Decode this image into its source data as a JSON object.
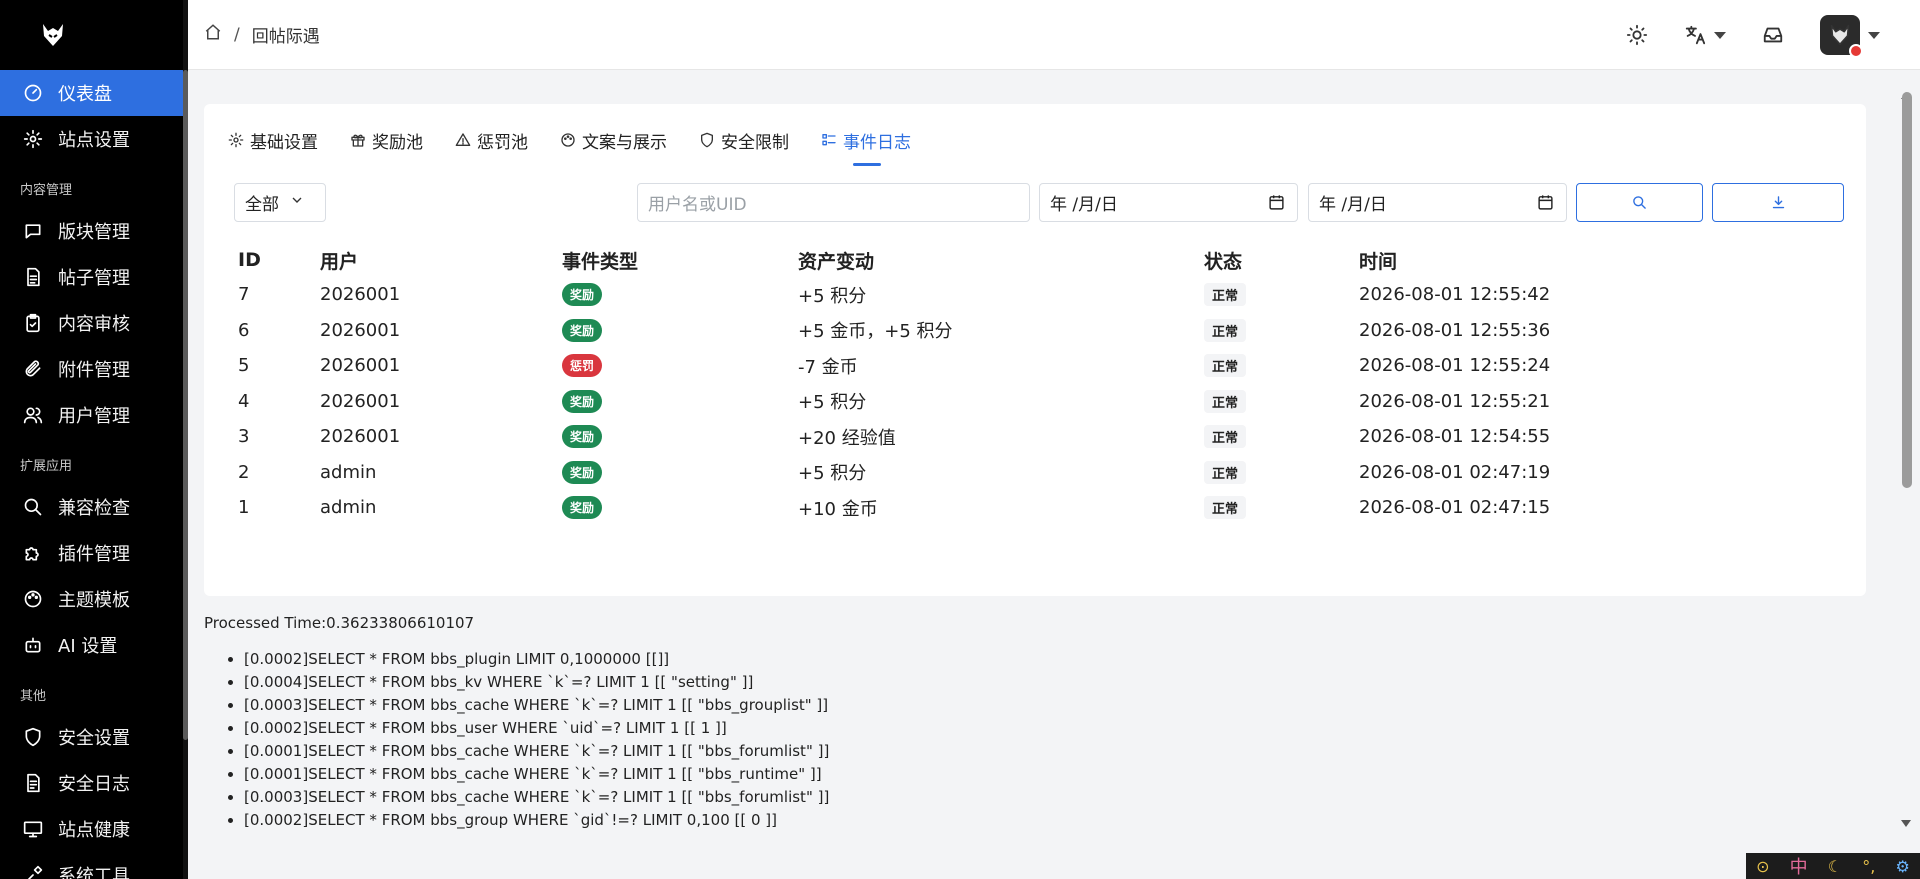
{
  "header": {
    "breadcrumb": "回帖际遇"
  },
  "sidebar": {
    "items": [
      {
        "label": "仪表盘",
        "icon": "dashboard-icon",
        "active": true
      },
      {
        "label": "站点设置",
        "icon": "gear-icon"
      }
    ],
    "sections": [
      {
        "title": "内容管理",
        "items": [
          {
            "label": "版块管理",
            "icon": "chat-icon"
          },
          {
            "label": "帖子管理",
            "icon": "document-icon"
          },
          {
            "label": "内容审核",
            "icon": "clipboard-check-icon"
          },
          {
            "label": "附件管理",
            "icon": "paperclip-icon"
          },
          {
            "label": "用户管理",
            "icon": "users-icon"
          }
        ]
      },
      {
        "title": "扩展应用",
        "items": [
          {
            "label": "兼容检查",
            "icon": "search-icon"
          },
          {
            "label": "插件管理",
            "icon": "puzzle-icon"
          },
          {
            "label": "主题模板",
            "icon": "palette-icon"
          },
          {
            "label": "AI 设置",
            "icon": "robot-icon"
          }
        ]
      },
      {
        "title": "其他",
        "items": [
          {
            "label": "安全设置",
            "icon": "shield-icon"
          },
          {
            "label": "安全日志",
            "icon": "log-icon"
          },
          {
            "label": "站点健康",
            "icon": "monitor-icon"
          },
          {
            "label": "系统工具",
            "icon": "tools-icon"
          }
        ]
      }
    ]
  },
  "tabs": [
    {
      "label": "基础设置",
      "icon": "gear-icon"
    },
    {
      "label": "奖励池",
      "icon": "gift-icon"
    },
    {
      "label": "惩罚池",
      "icon": "warning-icon"
    },
    {
      "label": "文案与展示",
      "icon": "palette-icon"
    },
    {
      "label": "安全限制",
      "icon": "shield-icon"
    },
    {
      "label": "事件日志",
      "icon": "list-icon",
      "active": true
    }
  ],
  "filters": {
    "type_select": "全部",
    "uid_placeholder": "用户名或UID",
    "date_from": "年 /月/日",
    "date_to": "年 /月/日"
  },
  "table": {
    "columns": [
      "ID",
      "用户",
      "事件类型",
      "资产变动",
      "状态",
      "时间"
    ],
    "rows": [
      {
        "id": "7",
        "user": "2026001",
        "type": "奖励",
        "kind": "reward",
        "asset": "+5 积分",
        "status": "正常",
        "time": "2026-08-01 12:55:42"
      },
      {
        "id": "6",
        "user": "2026001",
        "type": "奖励",
        "kind": "reward",
        "asset": "+5 金币，+5 积分",
        "status": "正常",
        "time": "2026-08-01 12:55:36"
      },
      {
        "id": "5",
        "user": "2026001",
        "type": "惩罚",
        "kind": "penalty",
        "asset": "-7 金币",
        "status": "正常",
        "time": "2026-08-01 12:55:24"
      },
      {
        "id": "4",
        "user": "2026001",
        "type": "奖励",
        "kind": "reward",
        "asset": "+5 积分",
        "status": "正常",
        "time": "2026-08-01 12:55:21"
      },
      {
        "id": "3",
        "user": "2026001",
        "type": "奖励",
        "kind": "reward",
        "asset": "+20 经验值",
        "status": "正常",
        "time": "2026-08-01 12:54:55"
      },
      {
        "id": "2",
        "user": "admin",
        "type": "奖励",
        "kind": "reward",
        "asset": "+5 积分",
        "status": "正常",
        "time": "2026-08-01 02:47:19"
      },
      {
        "id": "1",
        "user": "admin",
        "type": "奖励",
        "kind": "reward",
        "asset": "+10 金币",
        "status": "正常",
        "time": "2026-08-01 02:47:15"
      }
    ]
  },
  "debug": {
    "processed": "Processed Time:0.36233806610107",
    "queries": [
      "[0.0002]SELECT * FROM bbs_plugin LIMIT 0,1000000 [[]]",
      "[0.0004]SELECT * FROM bbs_kv WHERE `k`=? LIMIT 1 [[ \"setting\" ]]",
      "[0.0003]SELECT * FROM bbs_cache WHERE `k`=? LIMIT 1 [[ \"bbs_grouplist\" ]]",
      "[0.0002]SELECT * FROM bbs_user WHERE `uid`=? LIMIT 1 [[ 1 ]]",
      "[0.0001]SELECT * FROM bbs_cache WHERE `k`=? LIMIT 1 [[ \"bbs_forumlist\" ]]",
      "[0.0001]SELECT * FROM bbs_cache WHERE `k`=? LIMIT 1 [[ \"bbs_runtime\" ]]",
      "[0.0003]SELECT * FROM bbs_cache WHERE `k`=? LIMIT 1 [[ \"bbs_forumlist\" ]]",
      "[0.0002]SELECT * FROM bbs_group WHERE `gid`!=? LIMIT 0,100 [[ 0 ]]"
    ]
  },
  "dock": {
    "lang": "中"
  },
  "colors": {
    "accent": "#2e6fe0",
    "reward": "#1e8a54",
    "penalty": "#d9363e",
    "sidebar_bg": "#000000"
  }
}
